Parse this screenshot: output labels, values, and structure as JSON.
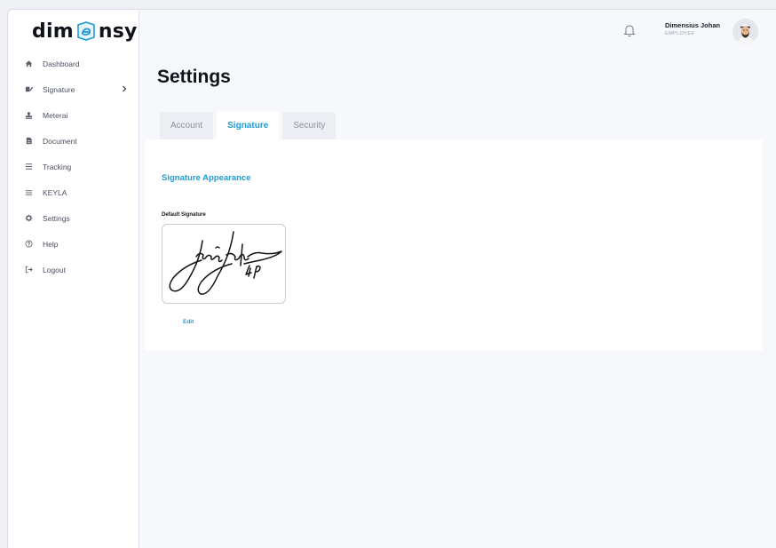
{
  "app": {
    "logo_left": "dim",
    "logo_right": "nsy"
  },
  "sidebar": {
    "items": [
      {
        "label": "Dashboard",
        "icon": "home-icon"
      },
      {
        "label": "Signature",
        "icon": "signature-icon",
        "has_submenu": true
      },
      {
        "label": "Meterai",
        "icon": "stamp-icon"
      },
      {
        "label": "Document",
        "icon": "document-icon"
      },
      {
        "label": "Tracking",
        "icon": "list-icon"
      },
      {
        "label": "KEYLA",
        "icon": "menu-icon"
      },
      {
        "label": "Settings",
        "icon": "gear-icon"
      },
      {
        "label": "Help",
        "icon": "help-icon"
      },
      {
        "label": "Logout",
        "icon": "logout-icon"
      }
    ]
  },
  "header": {
    "user_name": "Dimensius Johan",
    "user_role": "EMPLOYEE"
  },
  "page": {
    "title": "Settings",
    "tabs": [
      {
        "label": "Account",
        "active": false
      },
      {
        "label": "Signature",
        "active": true
      },
      {
        "label": "Security",
        "active": false
      }
    ]
  },
  "signature_section": {
    "title": "Signature Appearance",
    "default_label": "Default Signature",
    "edit_label": "Edit"
  },
  "colors": {
    "accent": "#1f9bd6",
    "text_dark": "#10131a",
    "text_muted": "#8b93a3"
  }
}
